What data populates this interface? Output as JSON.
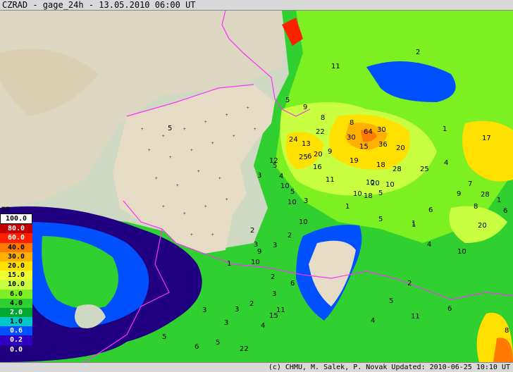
{
  "title": "CZRAD - gage_24h - 13.05.2010 06:00 UT",
  "footer": "(c) CHMU, M. Salek, P. Novak  Updated: 2010-06-25 10:10 UT",
  "legend": {
    "unit": "mm",
    "levels": [
      {
        "label": "100.0",
        "color": "#ffffff"
      },
      {
        "label": "80.0",
        "color": "#c00000"
      },
      {
        "label": "60.0",
        "color": "#ff2000"
      },
      {
        "label": "40.0",
        "color": "#ff7a00"
      },
      {
        "label": "30.0",
        "color": "#ffb000"
      },
      {
        "label": "20.0",
        "color": "#ffe000"
      },
      {
        "label": "15.0",
        "color": "#f0ff30"
      },
      {
        "label": "10.0",
        "color": "#c8ff40"
      },
      {
        "label": "6.0",
        "color": "#7cf020"
      },
      {
        "label": "4.0",
        "color": "#30d030"
      },
      {
        "label": "2.0",
        "color": "#00a830"
      },
      {
        "label": "1.0",
        "color": "#00c8c8"
      },
      {
        "label": "0.6",
        "color": "#0050ff"
      },
      {
        "label": "0.2",
        "color": "#3000c0"
      },
      {
        "label": "0.0",
        "color": "#200080"
      }
    ]
  },
  "station_values": [
    "11",
    "2",
    "5",
    "5",
    "9",
    "8",
    "22",
    "8",
    "64",
    "30",
    "1",
    "24",
    "13",
    "30",
    "15",
    "36",
    "20",
    "17",
    "25",
    "20",
    "19",
    "18",
    "12",
    "16",
    "6",
    "9",
    "28",
    "25",
    "5",
    "3",
    "4",
    "11",
    "10",
    "10",
    "20",
    "5",
    "18",
    "10",
    "9",
    "28",
    "7",
    "1",
    "4",
    "10",
    "5",
    "10",
    "3",
    "1",
    "6",
    "1",
    "20",
    "10",
    "5",
    "2",
    "3",
    "2",
    "3",
    "1",
    "4",
    "6",
    "1",
    "8",
    "10",
    "2",
    "10",
    "2",
    "6",
    "3",
    "2",
    "3",
    "4",
    "3",
    "9",
    "3",
    "5",
    "6",
    "22",
    "11",
    "5",
    "6",
    "15",
    "4",
    "11",
    "8",
    "5"
  ]
}
